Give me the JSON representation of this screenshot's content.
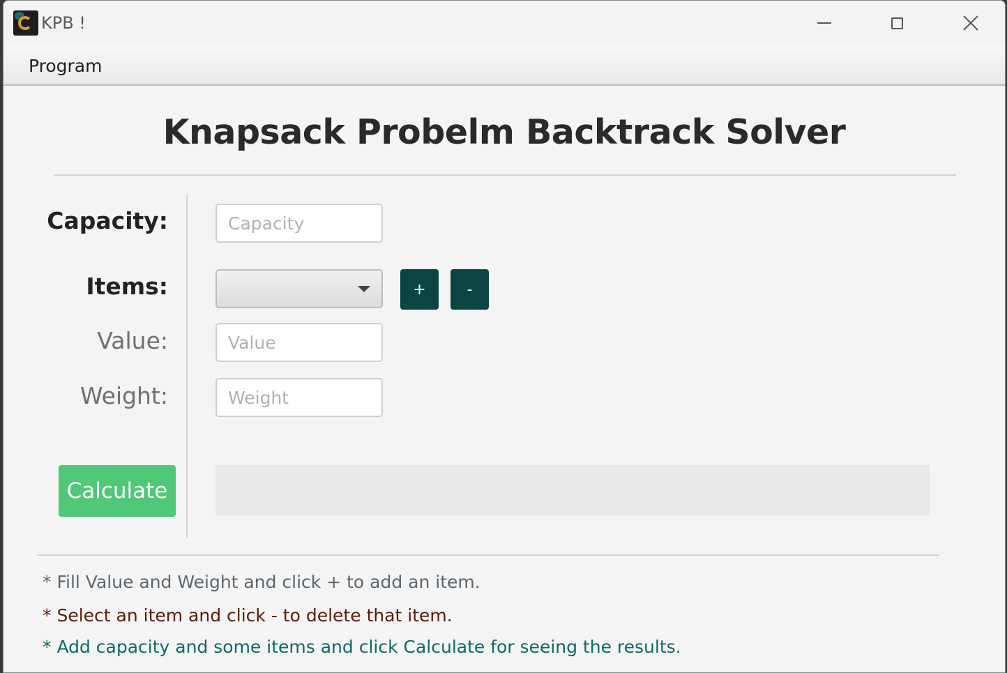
{
  "window": {
    "title": "KPB !",
    "icon": "app-logo-icon"
  },
  "menu": {
    "items": [
      {
        "label": "Program"
      }
    ]
  },
  "heading": "Knapsack Probelm Backtrack Solver",
  "form": {
    "capacity_label": "Capacity:",
    "capacity_placeholder": "Capacity",
    "items_label": "Items:",
    "items_selected": "",
    "add_label": "+",
    "remove_label": "-",
    "value_label": "Value:",
    "value_placeholder": "Value",
    "weight_label": "Weight:",
    "weight_placeholder": "Weight",
    "calculate_label": "Calculate",
    "result_text": ""
  },
  "hints": [
    {
      "text": "* Fill Value and Weight and click + to add an item.",
      "color": "#5c6770"
    },
    {
      "text": "* Select an item and click - to delete that item.",
      "color": "#5a1e08"
    },
    {
      "text": "* Add capacity and some items and click Calculate for seeing the results.",
      "color": "#0d6a66"
    }
  ],
  "colors": {
    "accent_dark": "#0b4543",
    "calculate_green": "#4fc878"
  }
}
